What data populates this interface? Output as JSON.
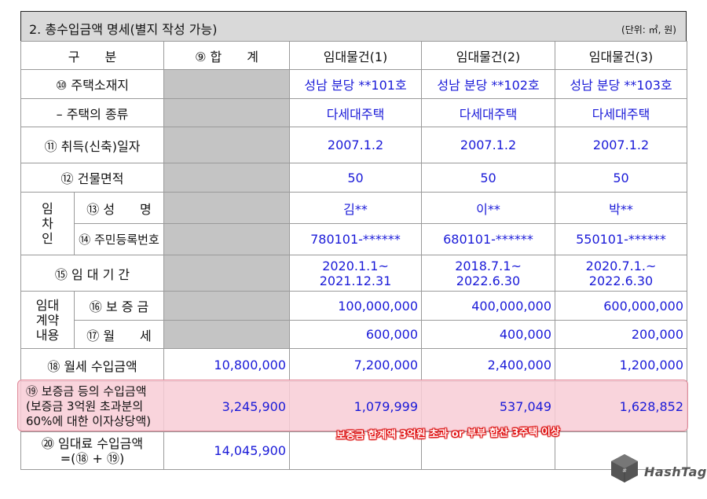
{
  "header": {
    "title": "2. 총수입금액 명세(별지 작성 가능)",
    "unit": "(단위: ㎡, 원)"
  },
  "columns": {
    "category": "구　　분",
    "total": "⑨ 합　　계",
    "p1": "임대물건(1)",
    "p2": "임대물건(2)",
    "p3": "임대물건(3)"
  },
  "rows": {
    "address": {
      "label": "⑩ 주택소재지",
      "p1": "성남 분당 **101호",
      "p2": "성남 분당 **102호",
      "p3": "성남 분당 **103호"
    },
    "house_type": {
      "label": "– 주택의 종류",
      "p1": "다세대주택",
      "p2": "다세대주택",
      "p3": "다세대주택"
    },
    "acq_date": {
      "label": "⑪ 취득(신축)일자",
      "p1": "2007.1.2",
      "p2": "2007.1.2",
      "p3": "2007.1.2"
    },
    "area": {
      "label": "⑫ 건물면적",
      "p1": "50",
      "p2": "50",
      "p3": "50"
    },
    "tenant_group": {
      "label_line1": "임",
      "label_line2": "차",
      "label_line3": "인"
    },
    "tenant_name": {
      "label": "⑬ 성　　명",
      "p1": "김**",
      "p2": "이**",
      "p3": "박**"
    },
    "tenant_id": {
      "label": "⑭ 주민등록번호",
      "p1": "780101-******",
      "p2": "680101-******",
      "p3": "550101-******"
    },
    "lease_period": {
      "label": "⑮ 임 대 기 간",
      "p1_line1": "2020.1.1~",
      "p1_line2": "2021.12.31",
      "p2_line1": "2018.7.1~",
      "p2_line2": "2022.6.30",
      "p3_line1": "2020.7.1.~",
      "p3_line2": "2022.6.30"
    },
    "contract_group": {
      "label_line1": "임대",
      "label_line2": "계약",
      "label_line3": "내용"
    },
    "deposit": {
      "label": "⑯ 보 증 금",
      "p1": "100,000,000",
      "p2": "400,000,000",
      "p3": "600,000,000"
    },
    "monthly_rent": {
      "label": "⑰ 월　　세",
      "p1": "600,000",
      "p2": "400,000",
      "p3": "200,000"
    },
    "rent_income": {
      "label": "⑱ 월세 수입금액",
      "total": "10,800,000",
      "p1": "7,200,000",
      "p2": "2,400,000",
      "p3": "1,200,000"
    },
    "deposit_income": {
      "label_line1": "⑲ 보증금 등의 수입금액",
      "label_line2": "(보증금 3억원 초과분의",
      "label_line3": "60%에 대한 이자상당액)",
      "total": "3,245,900",
      "p1": "1,079,999",
      "p2": "537,049",
      "p3": "1,628,852"
    },
    "total_income": {
      "label_line1": "⑳ 임대료 수입금액",
      "label_line2": "=(⑱ + ⑲)",
      "total": "14,045,900"
    }
  },
  "annotation": "보증금 합계액 3억원 초과 or 부부 합산 3주택 이상",
  "watermark": {
    "text": "HashTag",
    "icon": "hashtag-cube-logo"
  }
}
